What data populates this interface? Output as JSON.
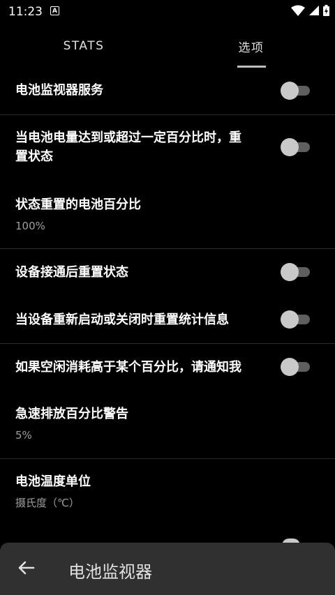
{
  "status_bar": {
    "time": "11:23",
    "notification_icon": "A"
  },
  "tabs": [
    {
      "label": "STATS"
    },
    {
      "label": "选项"
    }
  ],
  "settings": {
    "battery_monitor_service": {
      "title": "电池监视器服务",
      "enabled": false
    },
    "reset_on_percentage": {
      "title_line1": "当电池电量达到或超过一定百分比时，重",
      "title_line2": "置状态",
      "enabled": false
    },
    "reset_percentage": {
      "title": "状态重置的电池百分比",
      "value": "100%"
    },
    "reset_on_plug": {
      "title": "设备接通后重置状态",
      "enabled": false
    },
    "reset_on_reboot": {
      "title": "当设备重新启动或关闭时重置统计信息",
      "enabled": false
    },
    "notify_idle_drain": {
      "title": "如果空闲消耗高于某个百分比，请通知我",
      "enabled": false
    },
    "rapid_drain_warning": {
      "title": "急速排放百分比警告",
      "value": "5%"
    },
    "temperature_unit": {
      "title": "电池温度单位",
      "value": "摄氏度（℃）"
    }
  },
  "bottom_bar": {
    "title": "电池监视器"
  }
}
